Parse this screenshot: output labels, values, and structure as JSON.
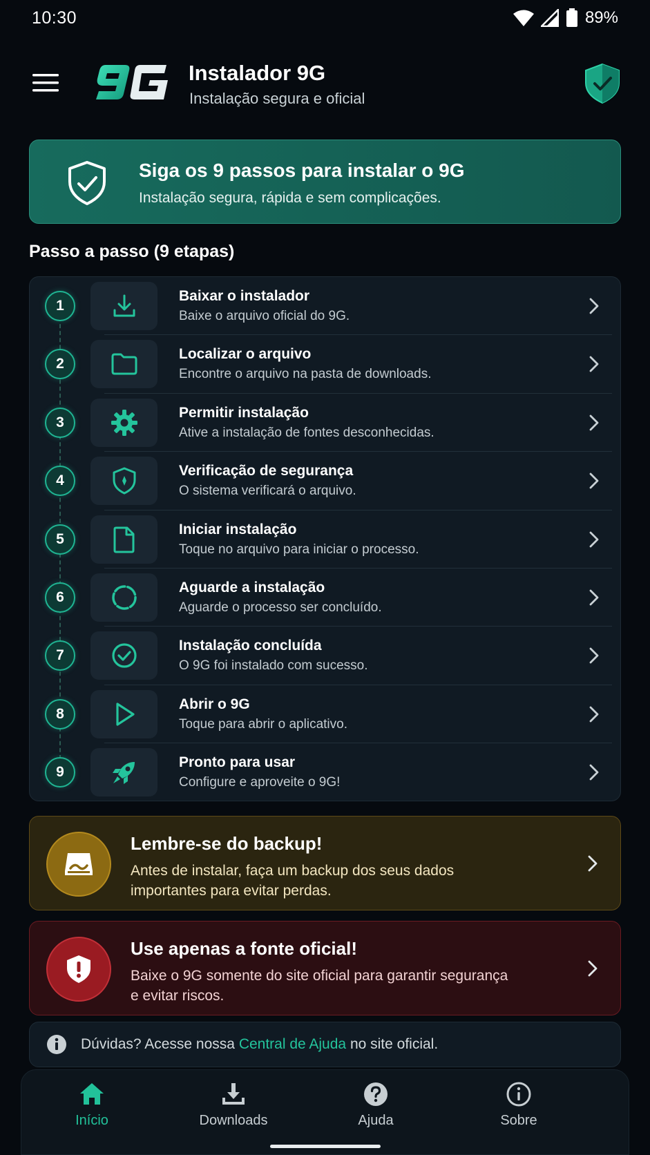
{
  "status_bar": {
    "time": "10:30",
    "battery": "89%",
    "icons": [
      "wifi-icon",
      "signal-icon",
      "battery-icon"
    ]
  },
  "header": {
    "logo_text": "9G",
    "title": "Instalador 9G",
    "subtitle": "Instalação segura e oficial",
    "menu_icon": "menu-icon",
    "shield_icon": "shield-check-icon"
  },
  "hero": {
    "title": "Siga os 9 passos para instalar o 9G",
    "subtitle": "Instalação segura, rápida e sem complicações.",
    "icon": "shield-check-icon"
  },
  "section_title": "Passo a passo (9 etapas)",
  "steps": [
    {
      "number": "1",
      "title": "Baixar o instalador",
      "desc": "Baixe o arquivo oficial do 9G.",
      "icon": "download-icon"
    },
    {
      "number": "2",
      "title": "Localizar o arquivo",
      "desc": "Encontre o arquivo na pasta de downloads.",
      "icon": "folder-icon"
    },
    {
      "number": "3",
      "title": "Permitir instalação",
      "desc": "Ative a instalação de fontes desconhecidas.",
      "icon": "gear-icon"
    },
    {
      "number": "4",
      "title": "Verificação de segurança",
      "desc": "O sistema verificará o arquivo.",
      "icon": "shield-icon"
    },
    {
      "number": "5",
      "title": "Iniciar instalação",
      "desc": "Toque no arquivo para iniciar o processo.",
      "icon": "file-icon"
    },
    {
      "number": "6",
      "title": "Aguarde a instalação",
      "desc": "Aguarde o processo ser concluído.",
      "icon": "loading-icon"
    },
    {
      "number": "7",
      "title": "Instalação concluída",
      "desc": "O 9G foi instalado com sucesso.",
      "icon": "check-circle-icon"
    },
    {
      "number": "8",
      "title": "Abrir o 9G",
      "desc": "Toque para abrir o aplicativo.",
      "icon": "play-icon"
    },
    {
      "number": "9",
      "title": "Pronto para usar",
      "desc": "Configure e aproveite o 9G!",
      "icon": "rocket-icon"
    }
  ],
  "alerts": {
    "backup": {
      "title": "Lembre-se do backup!",
      "text": "Antes de instalar, faça um backup dos seus dados importantes para evitar perdas.",
      "icon": "backup-drive-icon",
      "color": "#8c6a12"
    },
    "official": {
      "title": "Use apenas a fonte oficial!",
      "text": "Baixe o 9G somente do site oficial para garantir segurança e evitar riscos.",
      "icon": "shield-alert-icon",
      "color": "#9a1b22"
    }
  },
  "help": {
    "prefix": "Dúvidas? Acesse nossa",
    "link": "Central de Ajuda",
    "suffix": "no site oficial.",
    "icon": "info-icon"
  },
  "nav": [
    {
      "label": "Início",
      "icon": "home-icon",
      "active": true
    },
    {
      "label": "Downloads",
      "icon": "download-tray-icon",
      "active": false
    },
    {
      "label": "Ajuda",
      "icon": "help-circle-icon",
      "active": false
    },
    {
      "label": "Sobre",
      "icon": "info-icon",
      "active": false
    }
  ],
  "colors": {
    "accent": "#22c29a",
    "background": "#060a0f",
    "card": "#101a23",
    "hero": "#176b5d",
    "warning": "#8c6a12",
    "danger": "#9a1b22"
  }
}
